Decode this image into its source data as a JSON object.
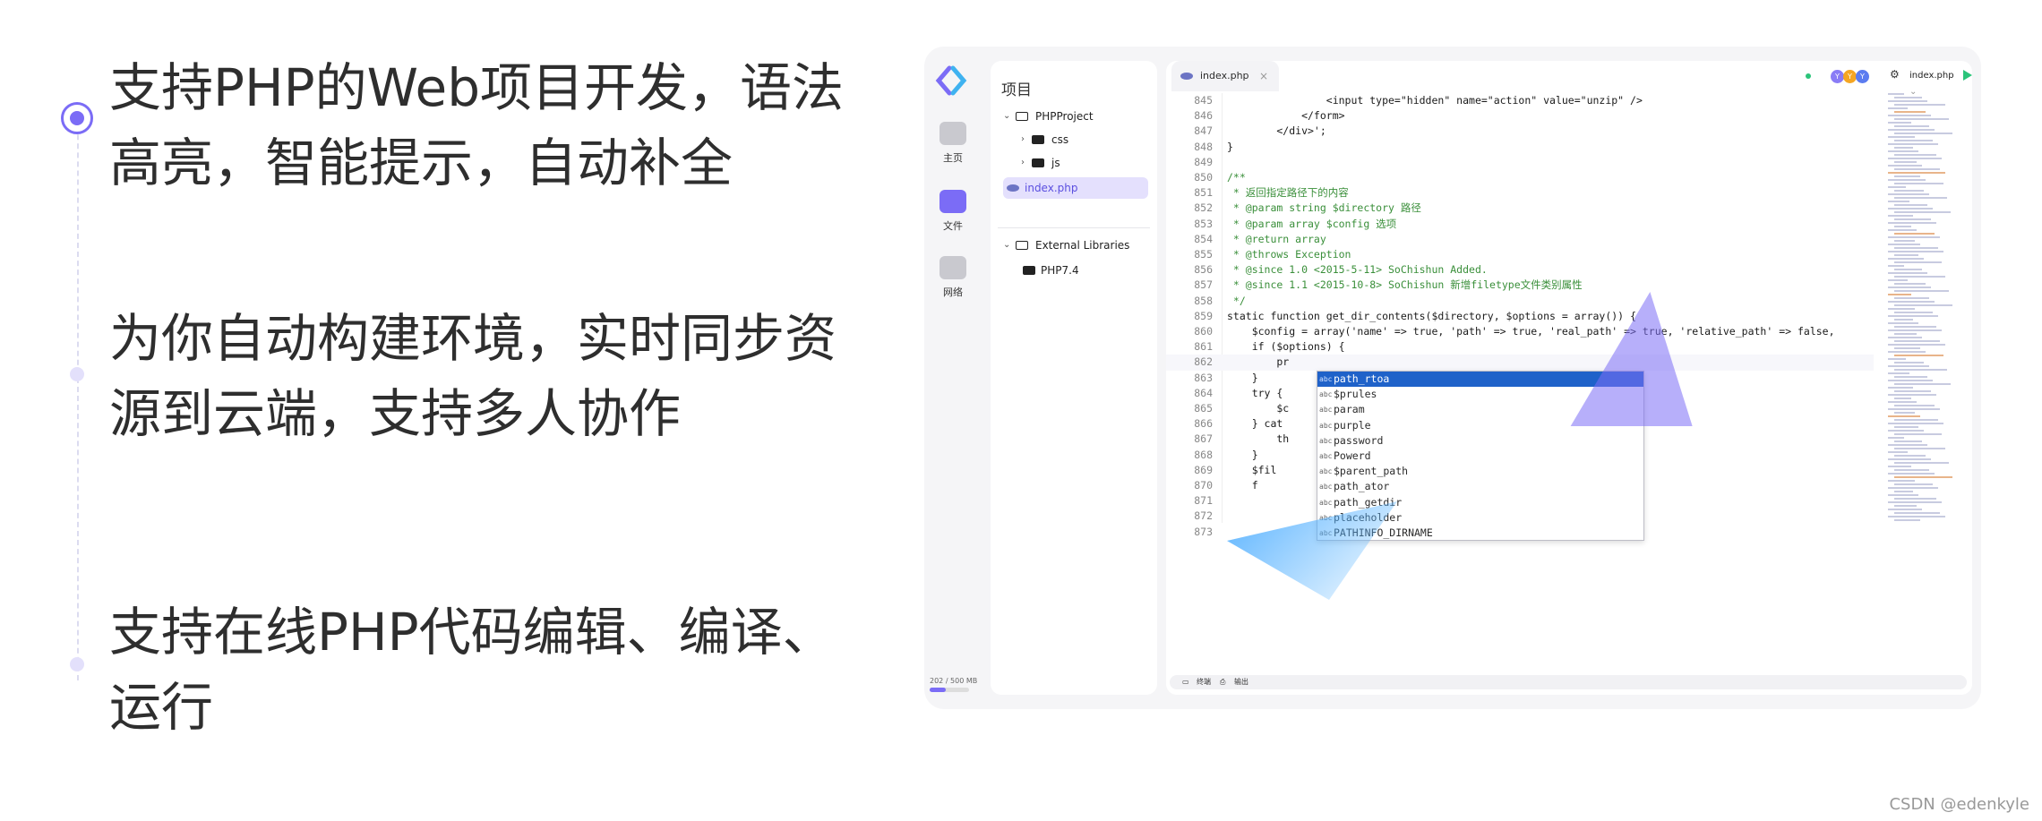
{
  "features": [
    {
      "line1": "支持PHP的Web项目开发，语法",
      "line2": "高亮，智能提示，自动补全"
    },
    {
      "line1": "为你自动构建环境，实时同步资",
      "line2": "源到云端，支持多人协作"
    },
    {
      "line1": "支持在线PHP代码编辑、编译、",
      "line2": "运行"
    }
  ],
  "ide": {
    "activity_bar": {
      "items": [
        {
          "label": "主页",
          "icon": "home-icon"
        },
        {
          "label": "文件",
          "icon": "file-icon"
        },
        {
          "label": "网络",
          "icon": "cloud-icon"
        }
      ],
      "quota_text": "202 / 500 MB",
      "quota_fraction": 0.4
    },
    "explorer": {
      "title": "项目",
      "tree": [
        {
          "label": "PHPProject"
        },
        {
          "label": "css"
        },
        {
          "label": "js"
        },
        {
          "label": "index.php"
        },
        {
          "label": "External Libraries"
        },
        {
          "label": "PHP7.4"
        }
      ]
    },
    "editor": {
      "tab_label": "index.php",
      "tab_close": "×",
      "avatars": [
        "Y",
        "Y",
        "Y"
      ],
      "avatar_colors": [
        "#8a7cf6",
        "#f5a623",
        "#5b7cf0"
      ],
      "file_select": "index.php",
      "lines": [
        {
          "n": "845",
          "t": "                <input type=\"hidden\" name=\"action\" value=\"unzip\" />"
        },
        {
          "n": "846",
          "t": "            </form>"
        },
        {
          "n": "847",
          "t": "        </div>';"
        },
        {
          "n": "848",
          "t": "}"
        },
        {
          "n": "849",
          "t": ""
        },
        {
          "n": "850",
          "t": "/**"
        },
        {
          "n": "851",
          "t": " * 返回指定路径下的内容"
        },
        {
          "n": "852",
          "t": " * @param string $directory 路径"
        },
        {
          "n": "853",
          "t": " * @param array $config 选项"
        },
        {
          "n": "854",
          "t": " * @return array"
        },
        {
          "n": "855",
          "t": " * @throws Exception"
        },
        {
          "n": "856",
          "t": " * @since 1.0 <2015-5-11> SoChishun Added."
        },
        {
          "n": "857",
          "t": " * @since 1.1 <2015-10-8> SoChishun 新增filetype文件类别属性"
        },
        {
          "n": "858",
          "t": " */"
        },
        {
          "n": "859",
          "t": "static function get_dir_contents($directory, $options = array()) {"
        },
        {
          "n": "860",
          "t": "    $config = array('name' => true, 'path' => true, 'real_path' => true, 'relative_path' => false,"
        },
        {
          "n": "861",
          "t": "    if ($options) {"
        },
        {
          "n": "862",
          "t": "        pr"
        },
        {
          "n": "863",
          "t": "    }"
        },
        {
          "n": "864",
          "t": "    try {"
        },
        {
          "n": "865",
          "t": "        $c"
        },
        {
          "n": "866",
          "t": "    } cat"
        },
        {
          "n": "867",
          "t": "        th"
        },
        {
          "n": "868",
          "t": "    }"
        },
        {
          "n": "869",
          "t": "    $fil"
        },
        {
          "n": "870",
          "t": "    f"
        },
        {
          "n": "871",
          "t": ""
        },
        {
          "n": "872",
          "t": ""
        },
        {
          "n": "873",
          "t": ""
        }
      ],
      "autocomplete": {
        "kind": "abc",
        "items": [
          "path_rtoa",
          "$prules",
          "param",
          "purple",
          "password",
          "Powerd",
          "$parent_path",
          "path_ator",
          "path_getdir",
          "placeholder",
          "PATHINFO_DIRNAME"
        ]
      },
      "bottom_bar": {
        "terminal": "终端",
        "output": "输出"
      }
    }
  },
  "watermark": "CSDN @edenkyle"
}
